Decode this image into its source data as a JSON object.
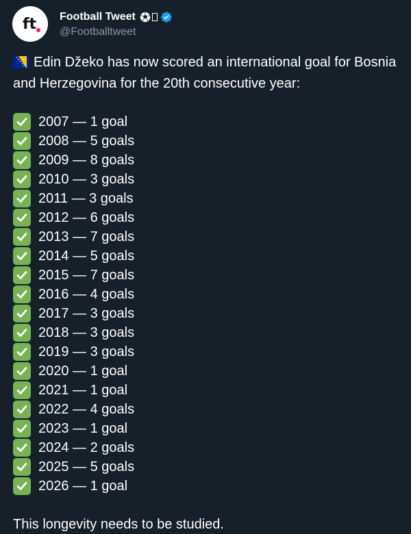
{
  "author": {
    "display_name": "Football Tweet",
    "handle": "@Footballtweet",
    "avatar_text": "ft"
  },
  "icons": {
    "avatar": "ft-logo-icon",
    "soccer_ball": "soccer-ball-icon",
    "missing_glyph": "missing-glyph-icon",
    "verified": "verified-badge-icon",
    "flag": "bosnia-flag-icon",
    "check": "check-mark-button-icon"
  },
  "colors": {
    "background": "#15202b",
    "text": "#ffffff",
    "handle": "#8b98a5",
    "verified": "#1d9bf0",
    "check": "#77b255",
    "flag_blue": "#002395",
    "flag_yellow": "#fecb00"
  },
  "tweet": {
    "intro": "Edin Džeko has now scored an international goal for Bosnia and Herzegovina for the 20th consecutive year:",
    "goals": [
      "2007 — 1 goal",
      "2008 — 5 goals",
      "2009 — 8 goals",
      "2010 — 3 goals",
      "2011 — 3 goals",
      "2012 — 6 goals",
      "2013 — 7 goals",
      "2014 — 5 goals",
      "2015 — 7 goals",
      "2016 — 4 goals",
      "2017 — 3 goals",
      "2018 — 3 goals",
      "2019 — 3 goals",
      "2020 — 1 goal",
      "2021 — 1 goal",
      "2022 — 4 goals",
      "2023 — 1 goal",
      "2024 — 2 goals",
      "2025 — 5 goals",
      "2026 — 1 goal"
    ],
    "outro": "This longevity needs to be studied."
  }
}
